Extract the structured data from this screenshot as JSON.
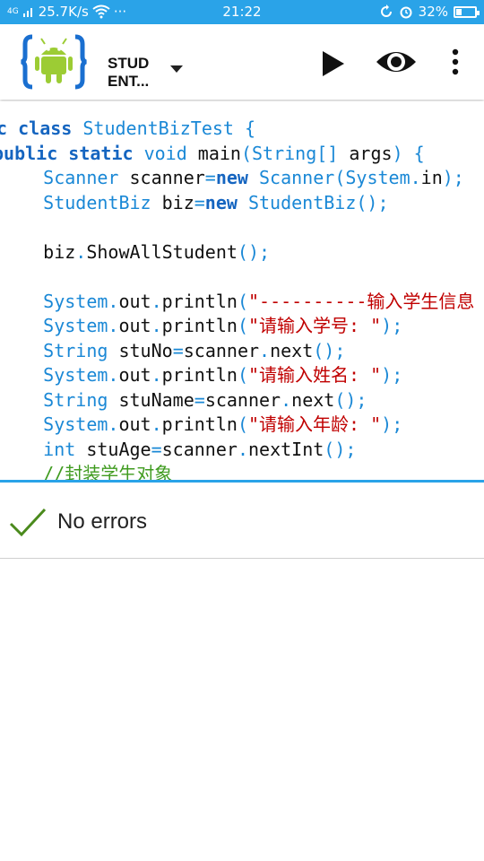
{
  "status_bar": {
    "network": "4G",
    "speed": "25.7K/s",
    "more": "···",
    "time": "21:22",
    "battery": "32%",
    "battery_level": 0.32
  },
  "toolbar": {
    "title": "STUD ENT...",
    "icons": [
      "aide-android-logo-icon",
      "dropdown-arrow-icon",
      "run-play-icon",
      "preview-eye-icon",
      "overflow-menu-icon"
    ]
  },
  "code": {
    "lines": [
      [
        [
          "kw",
          "ic class "
        ],
        [
          "ty",
          "StudentBizTest "
        ],
        [
          "pn",
          "{"
        ]
      ],
      [
        [
          "kw",
          "public static "
        ],
        [
          "ty",
          "void "
        ],
        [
          "",
          "main"
        ],
        [
          "pn",
          "("
        ],
        [
          "ty",
          "String"
        ],
        [
          "pn",
          "[] "
        ],
        [
          "",
          "args"
        ],
        [
          "pn",
          ") {"
        ]
      ],
      [
        [
          "",
          "    "
        ],
        [
          "ty",
          "Scanner "
        ],
        [
          "",
          "scanner"
        ],
        [
          "pn",
          "="
        ],
        [
          "kw",
          "new "
        ],
        [
          "ty",
          "Scanner"
        ],
        [
          "pn",
          "("
        ],
        [
          "ty",
          "System"
        ],
        [
          "pn",
          "."
        ],
        [
          "",
          "in"
        ],
        [
          "pn",
          ");"
        ]
      ],
      [
        [
          "",
          "    "
        ],
        [
          "ty",
          "StudentBiz "
        ],
        [
          "",
          "biz"
        ],
        [
          "pn",
          "="
        ],
        [
          "kw",
          "new "
        ],
        [
          "ty",
          "StudentBiz"
        ],
        [
          "pn",
          "();"
        ]
      ],
      [
        [
          "",
          ""
        ]
      ],
      [
        [
          "",
          "    biz"
        ],
        [
          "pn",
          "."
        ],
        [
          "",
          "ShowAllStudent"
        ],
        [
          "pn",
          "();"
        ]
      ],
      [
        [
          "",
          ""
        ]
      ],
      [
        [
          "",
          "    "
        ],
        [
          "ty",
          "System"
        ],
        [
          "pn",
          "."
        ],
        [
          "",
          "out"
        ],
        [
          "pn",
          "."
        ],
        [
          "",
          "println"
        ],
        [
          "pn",
          "("
        ],
        [
          "str",
          "\"----------输入学生信息"
        ]
      ],
      [
        [
          "",
          "    "
        ],
        [
          "ty",
          "System"
        ],
        [
          "pn",
          "."
        ],
        [
          "",
          "out"
        ],
        [
          "pn",
          "."
        ],
        [
          "",
          "println"
        ],
        [
          "pn",
          "("
        ],
        [
          "str",
          "\"请输入学号: \""
        ],
        [
          "pn",
          ");"
        ]
      ],
      [
        [
          "",
          "    "
        ],
        [
          "ty",
          "String "
        ],
        [
          "",
          "stuNo"
        ],
        [
          "pn",
          "="
        ],
        [
          "",
          "scanner"
        ],
        [
          "pn",
          "."
        ],
        [
          "",
          "next"
        ],
        [
          "pn",
          "();"
        ]
      ],
      [
        [
          "",
          "    "
        ],
        [
          "ty",
          "System"
        ],
        [
          "pn",
          "."
        ],
        [
          "",
          "out"
        ],
        [
          "pn",
          "."
        ],
        [
          "",
          "println"
        ],
        [
          "pn",
          "("
        ],
        [
          "str",
          "\"请输入姓名: \""
        ],
        [
          "pn",
          ");"
        ]
      ],
      [
        [
          "",
          "    "
        ],
        [
          "ty",
          "String "
        ],
        [
          "",
          "stuName"
        ],
        [
          "pn",
          "="
        ],
        [
          "",
          "scanner"
        ],
        [
          "pn",
          "."
        ],
        [
          "",
          "next"
        ],
        [
          "pn",
          "();"
        ]
      ],
      [
        [
          "",
          "    "
        ],
        [
          "ty",
          "System"
        ],
        [
          "pn",
          "."
        ],
        [
          "",
          "out"
        ],
        [
          "pn",
          "."
        ],
        [
          "",
          "println"
        ],
        [
          "pn",
          "("
        ],
        [
          "str",
          "\"请输入年龄: \""
        ],
        [
          "pn",
          ");"
        ]
      ],
      [
        [
          "",
          "    "
        ],
        [
          "ty",
          "int "
        ],
        [
          "",
          "stuAge"
        ],
        [
          "pn",
          "="
        ],
        [
          "",
          "scanner"
        ],
        [
          "pn",
          "."
        ],
        [
          "",
          "nextInt"
        ],
        [
          "pn",
          "();"
        ]
      ],
      [
        [
          "",
          "    "
        ],
        [
          "cm",
          "//封装学生对象"
        ]
      ]
    ]
  },
  "analysis": {
    "status": "No errors",
    "icon": "check-icon"
  },
  "colors": {
    "accent": "#2aa3e8",
    "keyword": "#1565c0",
    "type": "#1a88d6",
    "string": "#c00000",
    "comment": "#3f9b1f",
    "check": "#4a8a1c"
  }
}
